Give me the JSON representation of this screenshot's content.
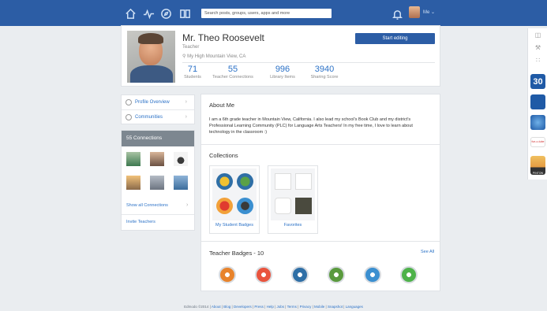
{
  "topbar": {
    "search_placeholder": "Search posts, groups, users, apps and more",
    "user_label": "Me ⌄",
    "icons": [
      "home-icon",
      "activity-icon",
      "discover-icon",
      "library-icon",
      "bell-icon"
    ]
  },
  "profile": {
    "name": "Mr. Theo Roosevelt",
    "role": "Teacher",
    "school": "My High Mountain View, CA",
    "start_button": "Start editing",
    "stats": [
      {
        "value": "71",
        "label": "Students"
      },
      {
        "value": "55",
        "label": "Teacher Connections"
      },
      {
        "value": "996",
        "label": "Library Items"
      },
      {
        "value": "3940",
        "label": "Sharing Score"
      }
    ]
  },
  "sidebar": {
    "items": [
      {
        "label": "Profile Overview"
      },
      {
        "label": "Communities"
      }
    ],
    "connections_title": "55 Connections",
    "show_all": "Show all Connections",
    "invite": "Invite Teachers"
  },
  "about": {
    "title": "About Me",
    "text": "I am a 6th grade teacher in Mountain View, California. I also lead my school's Book Club and my district's Professional Learning Community (PLC) for Language Arts Teachers! In my free time, I love to learn about technology in the classroom :)"
  },
  "collections": {
    "title": "Collections",
    "items": [
      {
        "label": "My Student Badges"
      },
      {
        "label": "Favorites"
      }
    ]
  },
  "badges": {
    "title": "Teacher Badges - 10",
    "see_all": "See All",
    "colors": [
      "#e8832b",
      "#e9543e",
      "#2f6fa6",
      "#5a9a3d",
      "#3b8fd0",
      "#4eb24a"
    ]
  },
  "rail": {
    "calendar_day": "30",
    "app_label": "PINTON",
    "app_label2": "fun-o-tube"
  },
  "footer": {
    "copyright": "Edmodo ©2014",
    "links": [
      "About",
      "Blog",
      "Developers",
      "Press",
      "Help",
      "Jobs",
      "Terms",
      "Privacy",
      "Mobile",
      "Snapshot",
      "Languages"
    ]
  }
}
